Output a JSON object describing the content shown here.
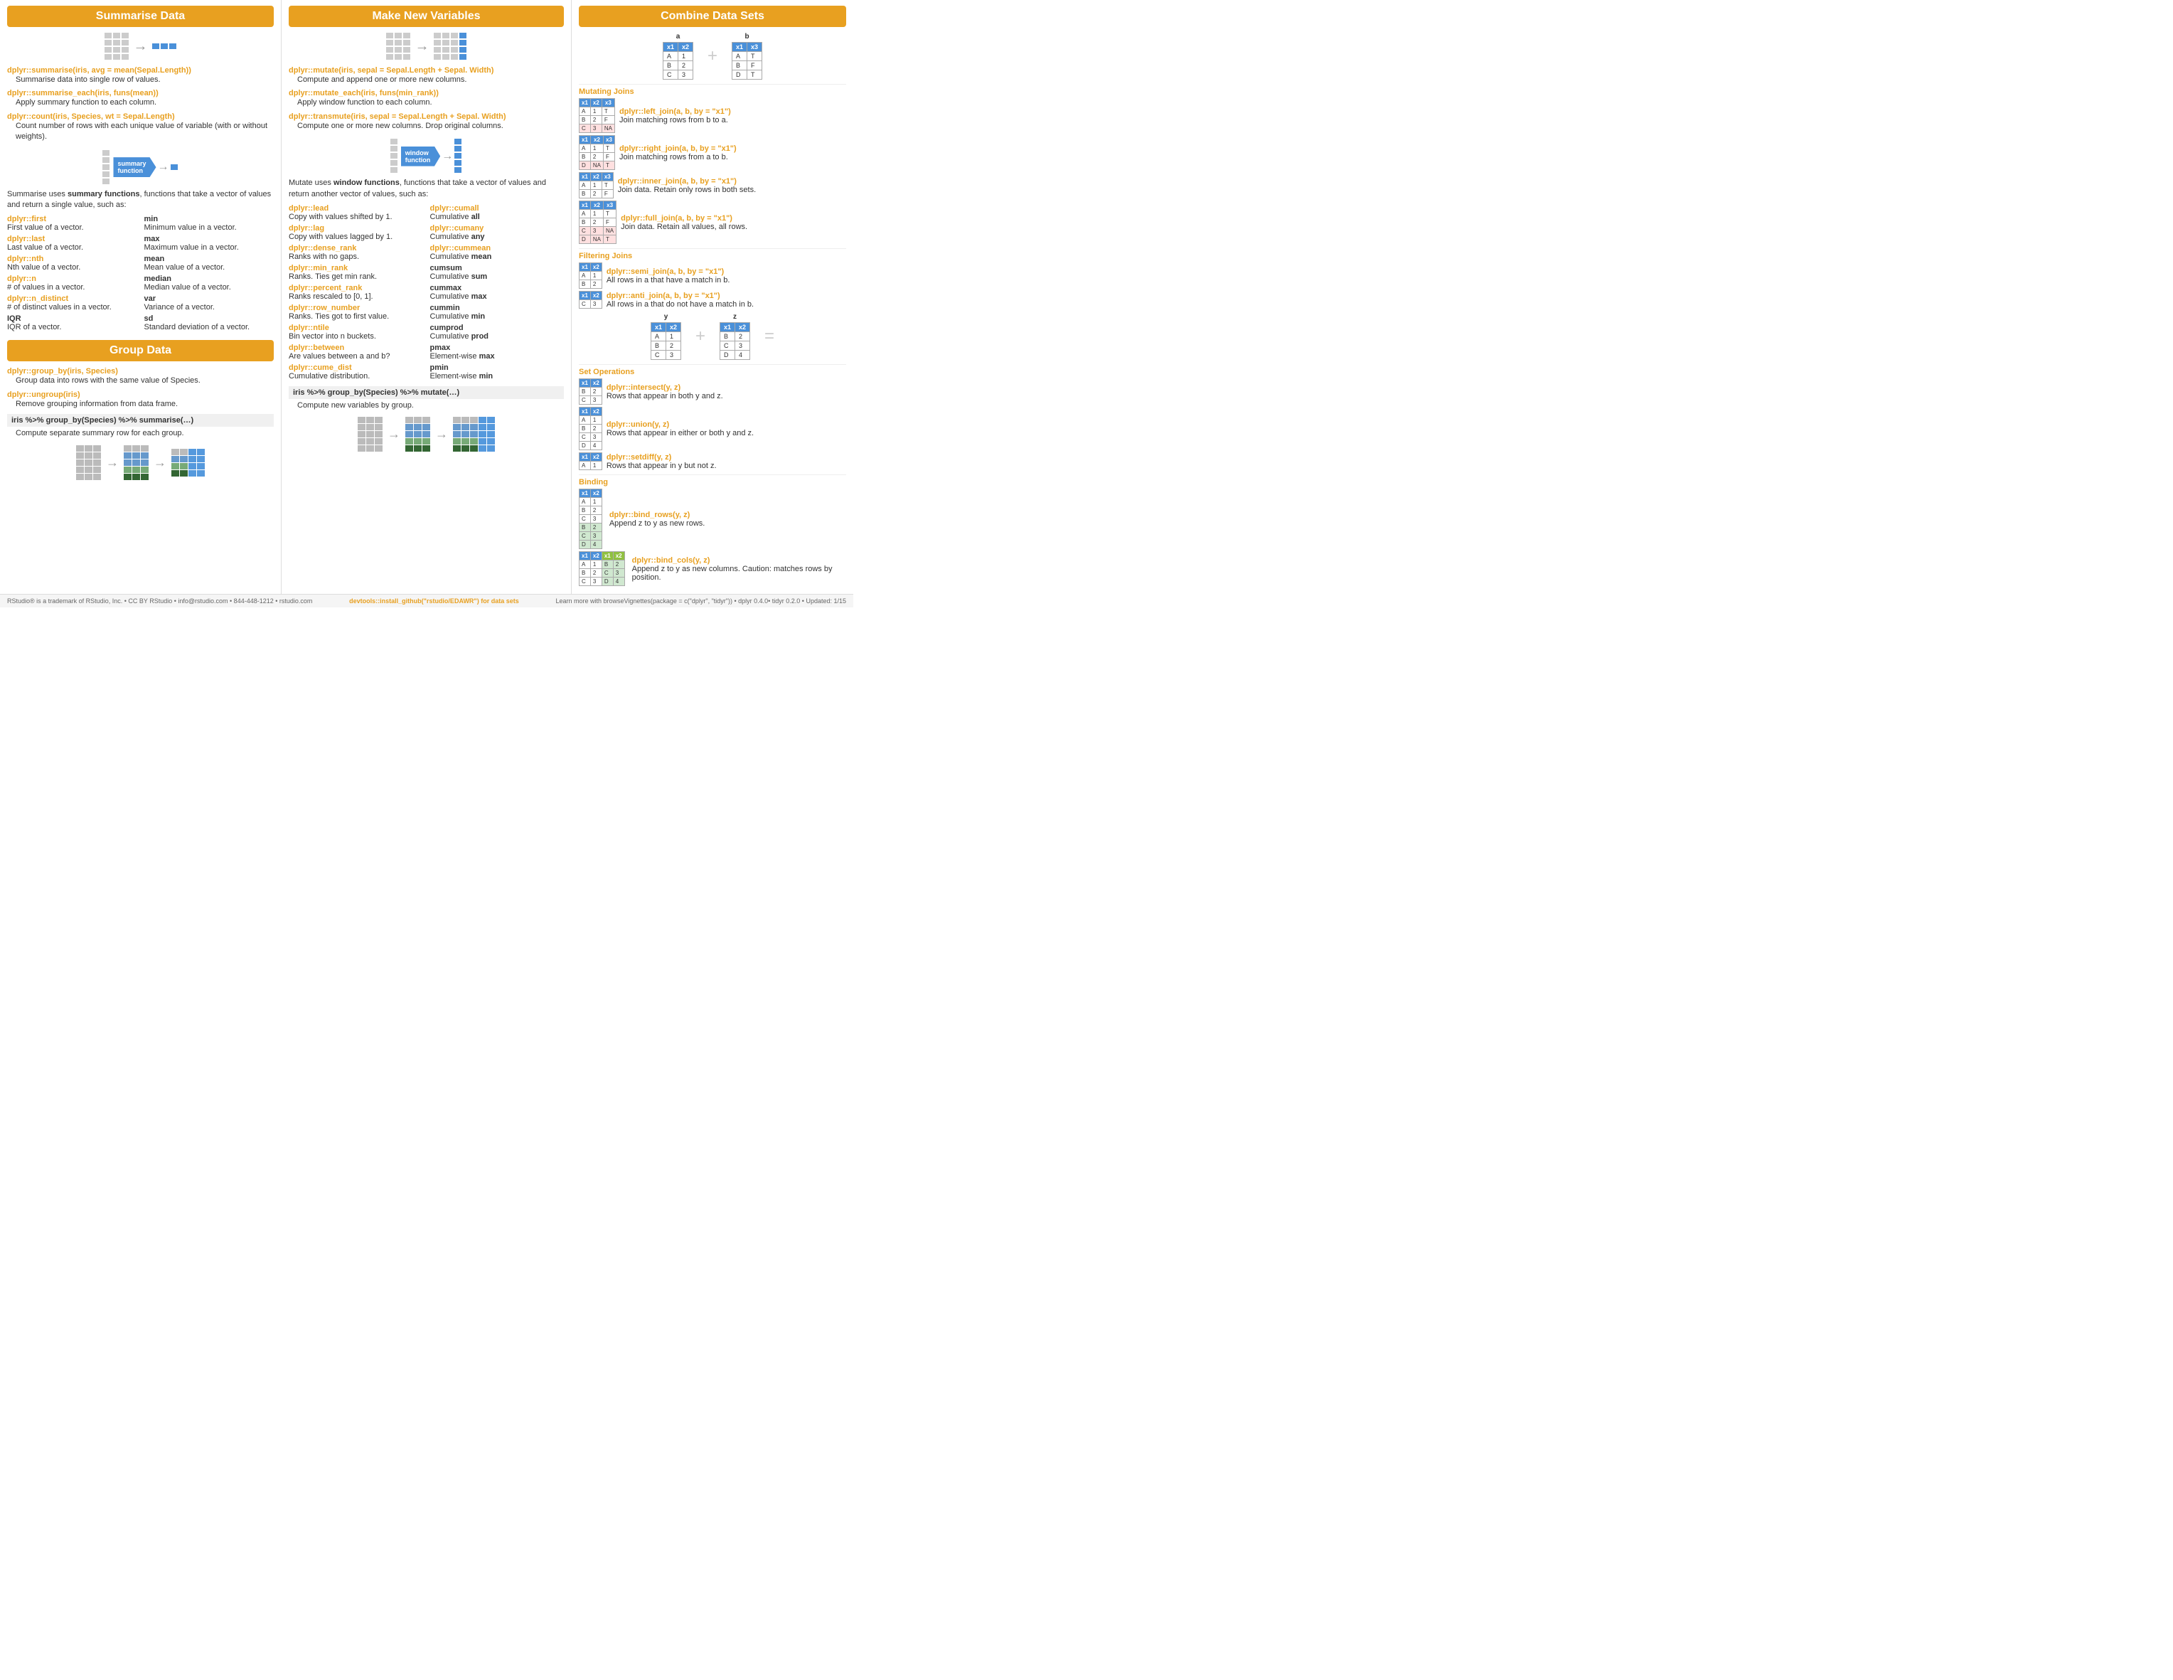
{
  "sections": {
    "summarise": {
      "title": "Summarise Data",
      "functions": [
        {
          "name": "dplyr::summarise(iris, avg = mean(Sepal.Length))",
          "desc": "Summarise data into single row of values."
        },
        {
          "name": "dplyr::summarise_each(iris, funs(mean))",
          "desc": "Apply summary function to each column."
        },
        {
          "name": "dplyr::count(iris, Species, wt = Sepal.Length)",
          "desc": "Count number of rows with each unique value of variable (with or without weights)."
        }
      ],
      "summary_note": "Summarise uses summary functions, functions that take a vector of values and return a single value, such as:",
      "summary_funcs": [
        {
          "name": "dplyr::first",
          "desc": "First value of a vector."
        },
        {
          "name": "dplyr::last",
          "desc": "Last value of a vector."
        },
        {
          "name": "dplyr::nth",
          "desc": "Nth value of a vector."
        },
        {
          "name": "dplyr::n",
          "desc": "# of values in a vector."
        },
        {
          "name": "dplyr::n_distinct",
          "desc": "# of distinct values in a vector."
        },
        {
          "name": "IQR",
          "desc": "IQR of a vector."
        }
      ],
      "summary_funcs_right": [
        {
          "name": "min",
          "desc": "Minimum value in a vector."
        },
        {
          "name": "max",
          "desc": "Maximum value in a vector."
        },
        {
          "name": "mean",
          "desc": "Mean value of a vector."
        },
        {
          "name": "median",
          "desc": "Median value of a vector."
        },
        {
          "name": "var",
          "desc": "Variance of a vector."
        },
        {
          "name": "sd",
          "desc": "Standard deviation of a vector."
        }
      ]
    },
    "group": {
      "title": "Group Data",
      "functions": [
        {
          "name": "dplyr::group_by(iris, Species)",
          "desc": "Group data into rows with the same value of Species."
        },
        {
          "name": "dplyr::ungroup(iris)",
          "desc": "Remove grouping information from data frame."
        }
      ],
      "pipeline": "iris %>% group_by(Species) %>% summarise(…)",
      "pipeline_desc": "Compute separate summary row for each group."
    },
    "make_new": {
      "title": "Make New Variables",
      "functions": [
        {
          "name": "dplyr::mutate(iris, sepal = Sepal.Length + Sepal. Width)",
          "desc": "Compute and append one or more new columns."
        },
        {
          "name": "dplyr::mutate_each(iris, funs(min_rank))",
          "desc": "Apply window function to each column."
        },
        {
          "name": "dplyr::transmute(iris, sepal = Sepal.Length + Sepal. Width)",
          "desc": "Compute one or more new columns. Drop original columns."
        }
      ],
      "window_note": "Mutate uses window functions, functions that take a vector of values and return another vector of values, such as:",
      "window_funcs_left": [
        {
          "name": "dplyr::lead",
          "desc": "Copy with values shifted by 1."
        },
        {
          "name": "dplyr::lag",
          "desc": "Copy with values lagged by 1."
        },
        {
          "name": "dplyr::dense_rank",
          "desc": "Ranks with no gaps."
        },
        {
          "name": "dplyr::min_rank",
          "desc": "Ranks. Ties get min rank."
        },
        {
          "name": "dplyr::percent_rank",
          "desc": "Ranks rescaled to [0, 1]."
        },
        {
          "name": "dplyr::row_number",
          "desc": "Ranks. Ties got to first value."
        },
        {
          "name": "dplyr::ntile",
          "desc": "Bin vector into n buckets."
        },
        {
          "name": "dplyr::between",
          "desc": "Are values between a and b?"
        },
        {
          "name": "dplyr::cume_dist",
          "desc": "Cumulative distribution."
        }
      ],
      "window_funcs_right": [
        {
          "name": "dplyr::cumall",
          "desc": "Cumulative all"
        },
        {
          "name": "dplyr::cumany",
          "desc": "Cumulative any"
        },
        {
          "name": "dplyr::cummean",
          "desc": "Cumulative mean"
        },
        {
          "name": "cumsum",
          "desc": "Cumulative sum"
        },
        {
          "name": "cummax",
          "desc": "Cumulative max"
        },
        {
          "name": "cummin",
          "desc": "Cumulative min"
        },
        {
          "name": "cumprod",
          "desc": "Cumulative prod"
        },
        {
          "name": "pmax",
          "desc": "Element-wise max"
        },
        {
          "name": "pmin",
          "desc": "Element-wise min"
        }
      ],
      "pipeline": "iris %>% group_by(Species) %>% mutate(…)",
      "pipeline_desc": "Compute new variables by group."
    },
    "combine": {
      "title": "Combine Data Sets",
      "mutating_joins_title": "Mutating Joins",
      "mutating_joins": [
        {
          "name": "dplyr::left_join(a, b, by = \"x1\")",
          "desc": "Join matching rows from b to a."
        },
        {
          "name": "dplyr::right_join(a, b, by = \"x1\")",
          "desc": "Join matching rows from a to b."
        },
        {
          "name": "dplyr::inner_join(a, b, by = \"x1\")",
          "desc": "Join data. Retain only rows in both sets."
        },
        {
          "name": "dplyr::full_join(a, b, by = \"x1\")",
          "desc": "Join data. Retain all values, all rows."
        }
      ],
      "filtering_joins_title": "Filtering Joins",
      "filtering_joins": [
        {
          "name": "dplyr::semi_join(a, b, by = \"x1\")",
          "desc": "All rows in a that have a match in b."
        },
        {
          "name": "dplyr::anti_join(a, b, by = \"x1\")",
          "desc": "All rows in a that do not have a match in b."
        }
      ],
      "set_ops_title": "Set Operations",
      "set_ops": [
        {
          "name": "dplyr::intersect(y, z)",
          "desc": "Rows that appear in both y and z."
        },
        {
          "name": "dplyr::union(y, z)",
          "desc": "Rows that appear in either or both y and z."
        },
        {
          "name": "dplyr::setdiff(y, z)",
          "desc": "Rows that appear in y but not z."
        }
      ],
      "binding_title": "Binding",
      "binding": [
        {
          "name": "dplyr::bind_rows(y, z)",
          "desc": "Append z to y as new rows."
        },
        {
          "name": "dplyr::bind_cols(y, z)",
          "desc": "Append z to y as new columns. Caution: matches rows by position."
        }
      ]
    }
  },
  "footer": {
    "left": "RStudio® is a trademark of RStudio, Inc. • CC BY RStudio • info@rstudio.com • 844-448-1212 • rstudio.com",
    "mid": "devtools::install_github(\"rstudio/EDAWR\") for data sets",
    "right": "Learn more with browseVignettes(package = c(\"dplyr\", \"tidyr\")) • dplyr 0.4.0• tidyr 0.2.0 • Updated: 1/15"
  }
}
